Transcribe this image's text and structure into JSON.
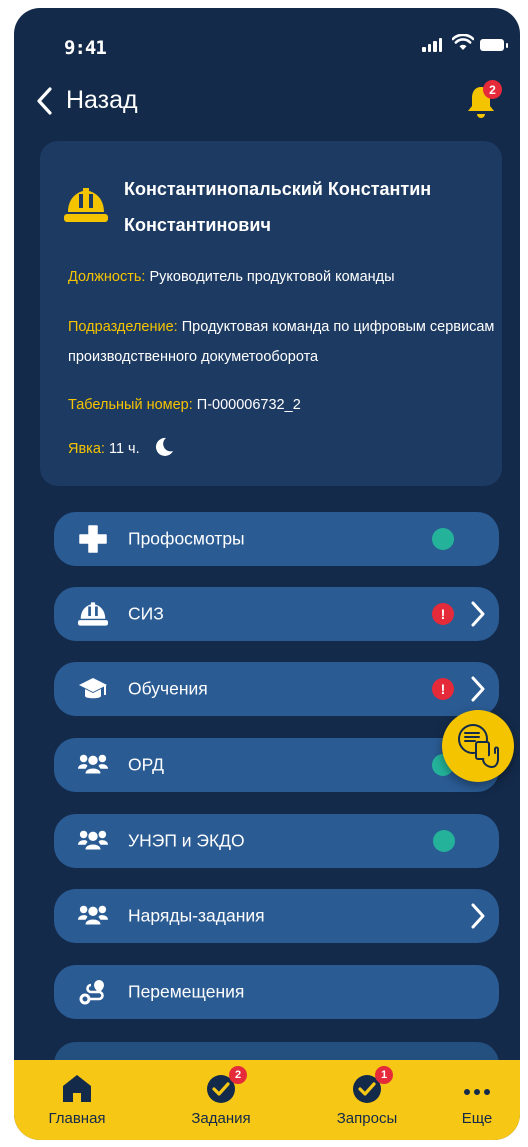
{
  "status": {
    "time": "9:41"
  },
  "header": {
    "back_label": "Назад",
    "notifications_count": "2"
  },
  "profile": {
    "name": "Константинопальский Константин Константинович",
    "position_label": "Должность:",
    "position_value": "Руководитель продуктовой команды",
    "division_label": "Подразделение:",
    "division_value": "Продуктовая команда по цифровым сервисам производственного докуметооборота",
    "tab_number_label": "Табельный номер:",
    "tab_number_value": "П-000006732_2",
    "attendance_label": "Явка:",
    "attendance_value": "11 ч."
  },
  "menu": {
    "items": [
      {
        "label": "Профосмотры",
        "icon": "plus-icon",
        "status": "ok"
      },
      {
        "label": "СИЗ",
        "icon": "hard-hat-icon",
        "status": "warning",
        "warning_text": "!"
      },
      {
        "label": "Обучения",
        "icon": "graduation-cap-icon",
        "status": "warning",
        "warning_text": "!"
      },
      {
        "label": "ОРД",
        "icon": "users-icon",
        "status": "ok"
      },
      {
        "label": "УНЭП и ЭКДО",
        "icon": "users-icon",
        "status": "ok"
      },
      {
        "label": "Наряды-задания",
        "icon": "users-icon",
        "status": "none"
      },
      {
        "label": "Перемещения",
        "icon": "route-icon",
        "status": "none"
      }
    ]
  },
  "tabbar": {
    "items": [
      {
        "label": "Главная",
        "icon": "home-icon"
      },
      {
        "label": "Задания",
        "icon": "check-circle-icon",
        "badge": "2"
      },
      {
        "label": "Запросы",
        "icon": "check-circle-icon",
        "badge": "1"
      },
      {
        "label": "Еще",
        "icon": "more-icon"
      }
    ]
  },
  "colors": {
    "background": "#132a4a",
    "card": "#1d3a62",
    "menu_item": "#2a5b93",
    "accent": "#f5c400",
    "ok": "#24b39a",
    "alert": "#e52a3a"
  }
}
